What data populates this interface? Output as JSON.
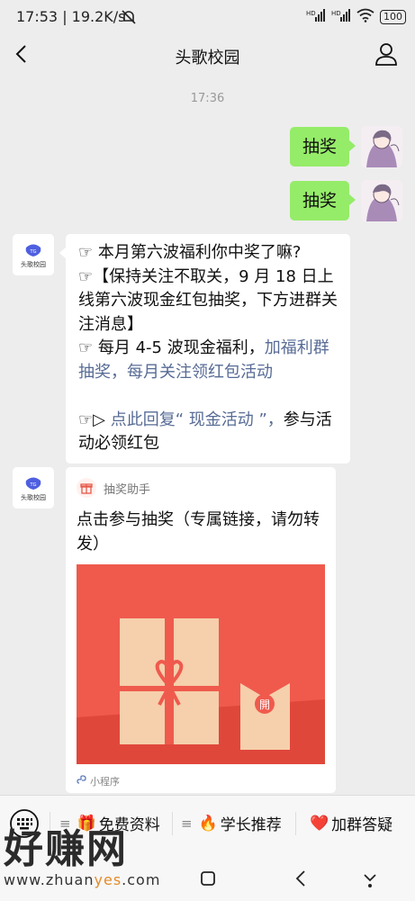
{
  "status_bar": {
    "time_speed": "17:53 | 19.2K/s",
    "battery": "100",
    "icons": [
      "mute-bell-icon",
      "hd-signal-icon",
      "hd-signal-icon",
      "wifi-icon",
      "battery-icon"
    ]
  },
  "nav": {
    "title": "头歌校园",
    "back_icon": "back-chevron-icon",
    "profile_icon": "person-icon"
  },
  "chat": {
    "time_separator": "17:36",
    "sent_messages": [
      "抽奖",
      "抽奖"
    ],
    "received_text": {
      "lines": [
        "☞ 本月第六波福利你中奖了嘛?",
        "☞【保持关注不取关，9 月 18 日上线第六波现金红包抽奖，下方进群关注消息】",
        "☞ 每月 4-5 波现金福利，",
        "加福利群抽奖，每月关注领红包活动",
        "☞▷ ",
        "点此回复“ 现金活动 ”，",
        "参与活动必领红包"
      ]
    },
    "mini_program": {
      "source": "抽奖助手",
      "title": "点击参与抽奖（专属链接，请勿转发）",
      "footer": "小程序",
      "image_badge": "開",
      "colors": {
        "background": "#ef5a4d",
        "gift": "#f7d0ad",
        "ribbon": "#ef5a4d"
      }
    },
    "avatar_left_label": "头歌校园"
  },
  "bottom_menu": {
    "items": [
      {
        "emoji": "🎁",
        "label": "免费资料"
      },
      {
        "emoji": "🔥",
        "label": "学长推荐"
      },
      {
        "emoji": "❤️",
        "label": "加群答疑"
      }
    ]
  },
  "watermark": {
    "big": "好赚网",
    "url_left": "www.zhuan",
    "url_mid": "yes",
    "url_right": ".com"
  }
}
